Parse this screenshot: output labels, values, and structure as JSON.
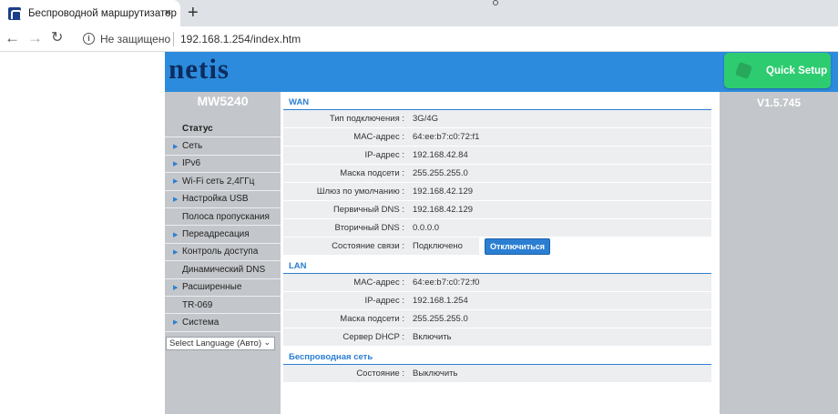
{
  "browser": {
    "tab_title": "Беспроводной маршрутизатор",
    "tab_close": "×",
    "new_tab": "+",
    "security_label": "Не защищено",
    "url": "192.168.1.254/index.htm"
  },
  "header": {
    "logo": "netis",
    "quick_setup": "Quick Setup"
  },
  "sidebar": {
    "model": "MW5240",
    "items": [
      {
        "label": "Статус",
        "arrow": false,
        "active": true
      },
      {
        "label": "Сеть",
        "arrow": true
      },
      {
        "label": "IPv6",
        "arrow": true
      },
      {
        "label": "Wi-Fi сеть 2,4ГГц",
        "arrow": true
      },
      {
        "label": "Настройка USB",
        "arrow": true
      },
      {
        "label": "Полоса пропускания",
        "arrow": false
      },
      {
        "label": "Переадресация",
        "arrow": true
      },
      {
        "label": "Контроль доступа",
        "arrow": true
      },
      {
        "label": "Динамический DNS",
        "arrow": false
      },
      {
        "label": "Расширенные",
        "arrow": true
      },
      {
        "label": "TR-069",
        "arrow": false
      },
      {
        "label": "Система",
        "arrow": true
      }
    ],
    "language_select": "Select Language (Авто)"
  },
  "version": "V1.5.745",
  "wan": {
    "title": "WAN",
    "rows": [
      {
        "label": "Тип подключения :",
        "value": "3G/4G"
      },
      {
        "label": "MAC-адрес :",
        "value": "64:ee:b7:c0:72:f1"
      },
      {
        "label": "IP-адрес :",
        "value": "192.168.42.84"
      },
      {
        "label": "Маска подсети :",
        "value": "255.255.255.0"
      },
      {
        "label": "Шлюз по умолчанию :",
        "value": "192.168.42.129"
      },
      {
        "label": "Первичный DNS :",
        "value": "192.168.42.129"
      },
      {
        "label": "Вторичный DNS :",
        "value": "0.0.0.0"
      }
    ],
    "status_label": "Состояние связи :",
    "status_value": "Подключено",
    "disconnect_button": "Отключиться"
  },
  "lan": {
    "title": "LAN",
    "rows": [
      {
        "label": "MAC-адрес :",
        "value": "64:ee:b7:c0:72:f0"
      },
      {
        "label": "IP-адрес :",
        "value": "192.168.1.254"
      },
      {
        "label": "Маска подсети :",
        "value": "255.255.255.0"
      },
      {
        "label": "Сервер DHCP :",
        "value": "Включить"
      }
    ]
  },
  "wireless": {
    "title": "Беспроводная сеть",
    "rows": [
      {
        "label": "Состояние :",
        "value": "Выключить"
      }
    ]
  }
}
